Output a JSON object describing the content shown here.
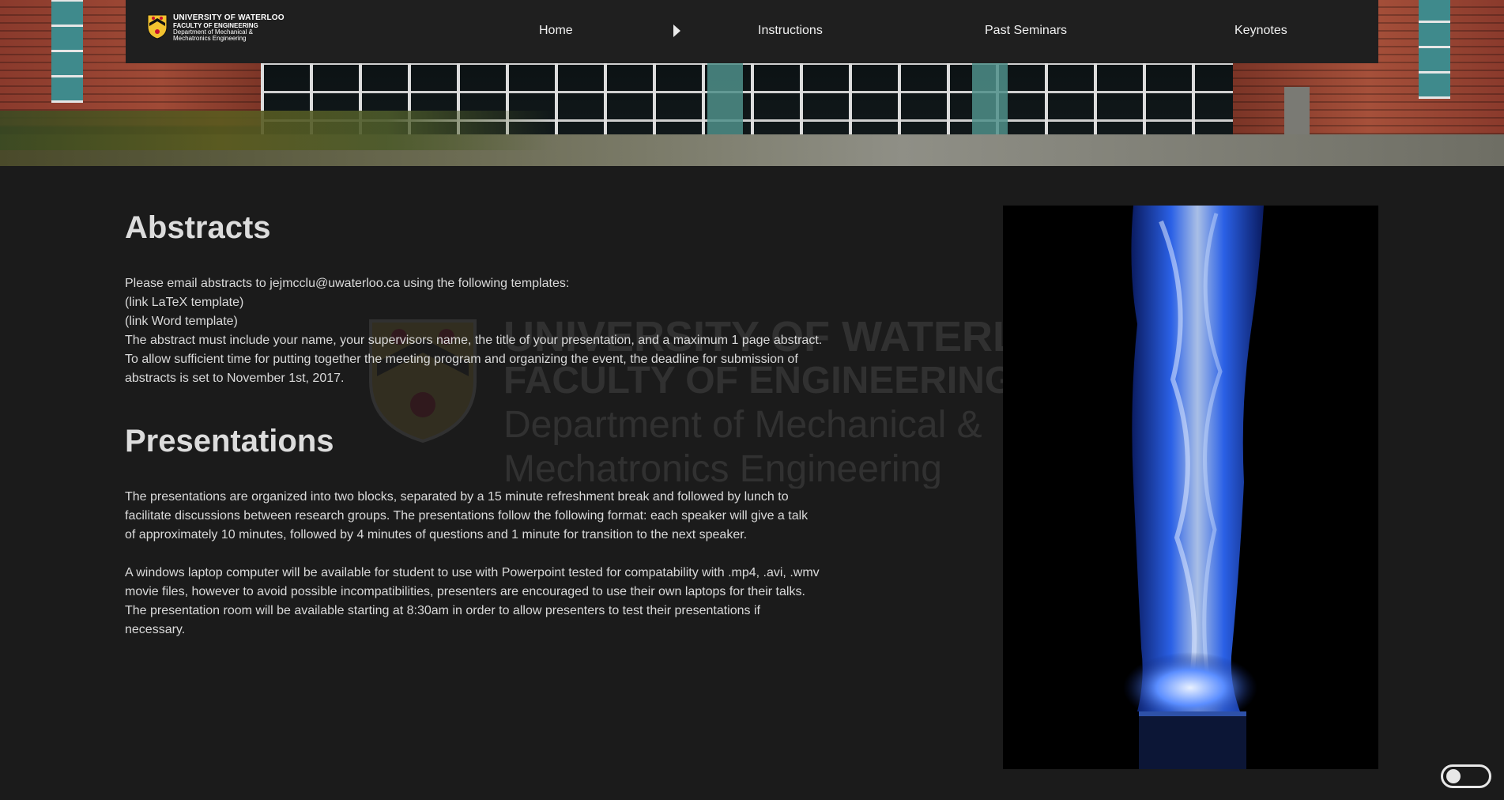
{
  "header": {
    "logo": {
      "line1": "UNIVERSITY OF WATERLOO",
      "line2": "FACULTY OF ENGINEERING",
      "line3": "Department of Mechanical &",
      "line4": "Mechatronics Engineering"
    },
    "nav": {
      "home": "Home",
      "instructions": "Instructions",
      "past_seminars": "Past Seminars",
      "keynotes": "Keynotes"
    }
  },
  "watermark": {
    "line1": "UNIVERSITY OF WATERLOO",
    "line2": "FACULTY OF ENGINEERING",
    "line3": "Department of Mechanical &",
    "line4": "Mechatronics Engineering"
  },
  "abstracts": {
    "heading": "Abstracts",
    "lines": [
      "Please email abstracts to jejmcclu@uwaterloo.ca using the following templates:",
      "(link LaTeX template)",
      "(link Word template)",
      "The abstract must include your name, your supervisors name, the title of your presentation, and a maximum 1 page abstract.",
      "To allow sufficient time for putting together the meeting program and organizing the event, the deadline for submission of",
      "abstracts is set to November 1st, 2017."
    ]
  },
  "presentations": {
    "heading": "Presentations",
    "paragraph1": [
      "The presentations are organized into two blocks, separated by a 15 minute refreshment break and followed by lunch to",
      "facilitate discussions between research groups. The presentations follow the following format: each speaker will give a talk",
      "of approximately 10 minutes, followed by 4 minutes of questions and 1 minute for transition to the next speaker."
    ],
    "paragraph2": [
      "A windows laptop computer will be available for student to use with Powerpoint tested for compatability with .mp4, .avi, .wmv",
      "movie files, however to avoid possible incompatibilities, presenters are encouraged to use their own laptops for their talks.",
      "The presentation room will be available starting at 8:30am in order to allow presenters to test their presentations if",
      "necessary."
    ]
  },
  "colors": {
    "background": "#1b1b1b",
    "navbar": "#1f1f1f",
    "flame_blue": "#3f7fff"
  }
}
